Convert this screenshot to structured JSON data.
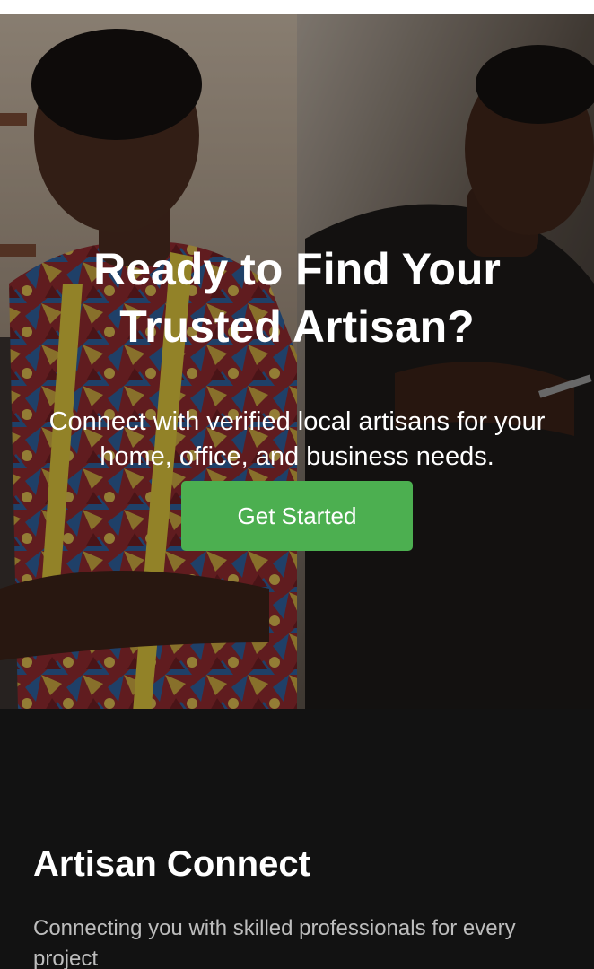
{
  "hero": {
    "title_line1": "Ready to Find Your",
    "title_line2": "Trusted Artisan?",
    "subtitle_line1": "Connect with verified local artisans for your",
    "subtitle_line2": "home, office, and business needs.",
    "cta_label": "Get Started"
  },
  "footer": {
    "brand": "Artisan Connect",
    "tagline_line1": "Connecting you with skilled professionals for every",
    "tagline_line2": "project"
  },
  "colors": {
    "accent": "#4caf50",
    "background": "#121212",
    "text": "#ffffff",
    "muted_text": "#bdbdbd"
  }
}
